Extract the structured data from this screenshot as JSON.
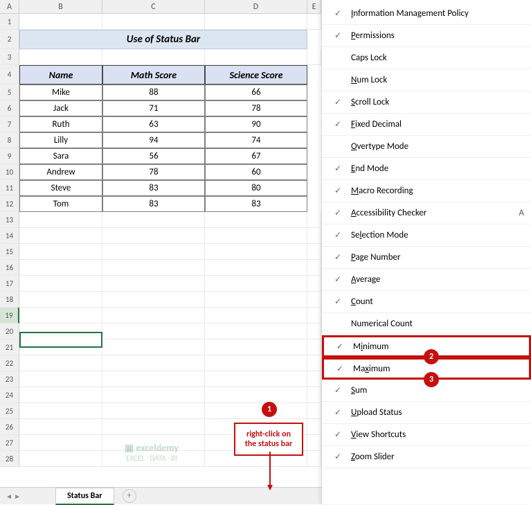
{
  "columns": [
    "A",
    "B",
    "C",
    "D",
    "E"
  ],
  "title": "Use of Status Bar",
  "table": {
    "headers": [
      "Name",
      "Math Score",
      "Science Score"
    ],
    "rows": [
      [
        "Mike",
        "88",
        "66"
      ],
      [
        "Jack",
        "71",
        "78"
      ],
      [
        "Ruth",
        "63",
        "90"
      ],
      [
        "Lilly",
        "94",
        "74"
      ],
      [
        "Sara",
        "56",
        "67"
      ],
      [
        "Andrew",
        "78",
        "60"
      ],
      [
        "Steve",
        "83",
        "80"
      ],
      [
        "Tom",
        "83",
        "83"
      ]
    ]
  },
  "selected_row": 19,
  "sheet_tab": "Status Bar",
  "menu": [
    {
      "label": "Information Management Policy",
      "u": 0,
      "checked": true
    },
    {
      "label": "Permissions",
      "u": 0,
      "checked": true
    },
    {
      "label": "Caps Lock",
      "u": -1,
      "checked": false
    },
    {
      "label": "Num Lock",
      "u": 0,
      "checked": false
    },
    {
      "label": "Scroll Lock",
      "u": 0,
      "checked": true
    },
    {
      "label": "Fixed Decimal",
      "u": 0,
      "checked": true
    },
    {
      "label": "Overtype Mode",
      "u": 0,
      "checked": false
    },
    {
      "label": "End Mode",
      "u": 0,
      "checked": true
    },
    {
      "label": "Macro Recording",
      "u": 0,
      "checked": true
    },
    {
      "label": "Accessibility Checker",
      "u": 0,
      "checked": true,
      "extra": "A"
    },
    {
      "label": "Selection Mode",
      "u": 2,
      "checked": true
    },
    {
      "label": "Page Number",
      "u": 0,
      "checked": true
    },
    {
      "label": "Average",
      "u": 0,
      "checked": true
    },
    {
      "label": "Count",
      "u": 0,
      "checked": true
    },
    {
      "label": "Numerical Count",
      "u": -1,
      "checked": false
    },
    {
      "label": "Minimum",
      "u": 1,
      "checked": true,
      "boxed": true,
      "badge": "2"
    },
    {
      "label": "Maximum",
      "u": 2,
      "checked": true,
      "boxed": true,
      "badge": "3"
    },
    {
      "label": "Sum",
      "u": 0,
      "checked": true
    },
    {
      "label": "Upload Status",
      "u": 0,
      "checked": true
    },
    {
      "label": "View Shortcuts",
      "u": 0,
      "checked": true
    },
    {
      "label": "Zoom Slider",
      "u": 0,
      "checked": true
    }
  ],
  "annotation": {
    "badge1": "1",
    "text": "right-click on the status bar"
  },
  "watermark": {
    "logo": "exceldemy",
    "sub": "EXCEL · DATA · BI"
  },
  "add_tab_icon": "+"
}
